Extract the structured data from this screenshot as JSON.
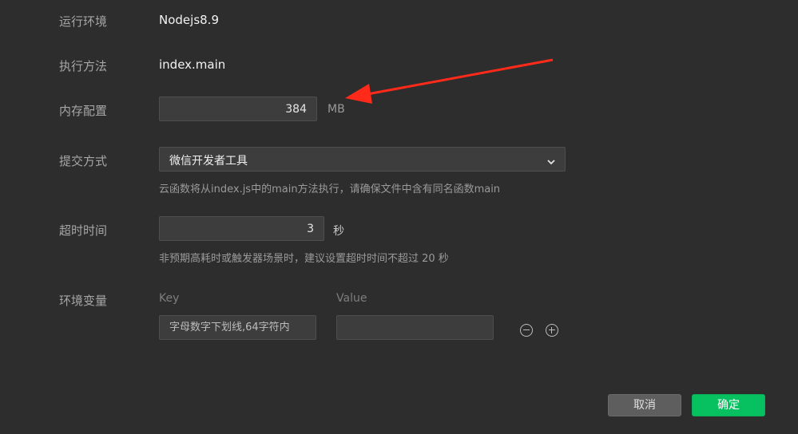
{
  "form": {
    "runtime": {
      "label": "运行环境",
      "value": "Nodejs8.9"
    },
    "handler": {
      "label": "执行方法",
      "value": "index.main"
    },
    "memory": {
      "label": "内存配置",
      "value": "384",
      "unit": "MB"
    },
    "submit": {
      "label": "提交方式",
      "selected": "微信开发者工具",
      "hint": "云函数将从index.js中的main方法执行，请确保文件中含有同名函数main"
    },
    "timeout": {
      "label": "超时时间",
      "value": "3",
      "unit": "秒",
      "hint": "非预期高耗时或触发器场景时，建议设置超时时间不超过 20 秒"
    },
    "env": {
      "label": "环境变量",
      "key_header": "Key",
      "value_header": "Value",
      "key_placeholder": "字母数字下划线,64字符内",
      "value_value": ""
    }
  },
  "buttons": {
    "cancel": "取消",
    "confirm": "确定"
  },
  "colors": {
    "accent": "#07c160",
    "annotation": "#ff2a1a"
  },
  "icons": {
    "select": "chevron-down-icon",
    "remove": "minus-circle-icon",
    "add": "plus-circle-icon",
    "arrow": "red-arrow-annotation-icon"
  }
}
